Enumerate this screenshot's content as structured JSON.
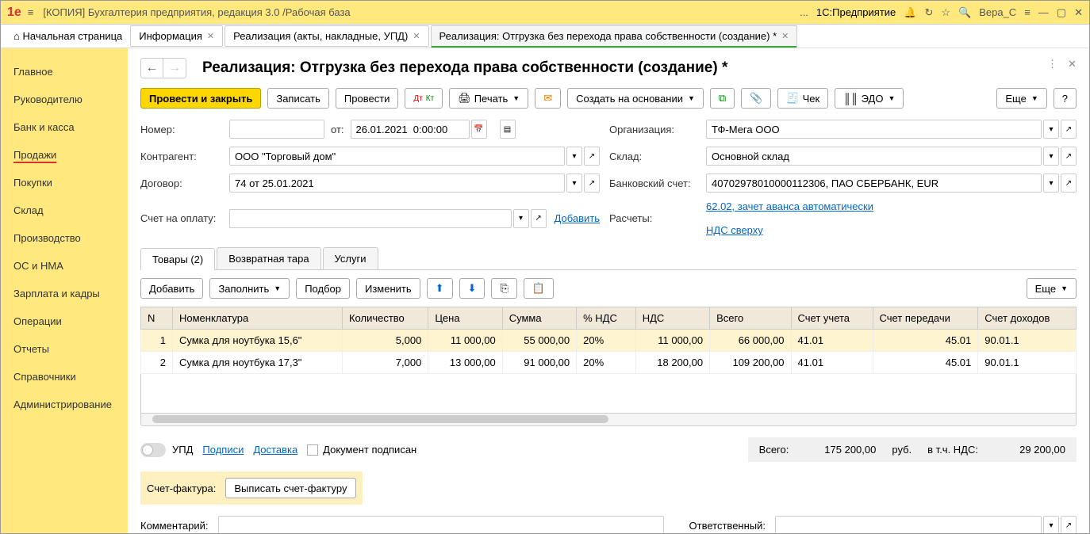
{
  "titlebar": {
    "app_title": "[КОПИЯ] Бухгалтерия предприятия, редакция 3.0 /Рабочая база",
    "platform": "1С:Предприятие",
    "user": "Вера_С"
  },
  "top_tabs": {
    "home": "Начальная страница",
    "items": [
      "Информация",
      "Реализация (акты, накладные, УПД)",
      "Реализация: Отгрузка без перехода права собственности (создание) *"
    ]
  },
  "sidebar": {
    "items": [
      "Главное",
      "Руководителю",
      "Банк и касса",
      "Продажи",
      "Покупки",
      "Склад",
      "Производство",
      "ОС и НМА",
      "Зарплата и кадры",
      "Операции",
      "Отчеты",
      "Справочники",
      "Администрирование"
    ],
    "active_index": 3
  },
  "page": {
    "title": "Реализация: Отгрузка без перехода права собственности (создание) *"
  },
  "toolbar": {
    "post_close": "Провести и закрыть",
    "save": "Записать",
    "post": "Провести",
    "print": "Печать",
    "create_based": "Создать на основании",
    "check": "Чек",
    "edo": "ЭДО",
    "more": "Еще"
  },
  "form": {
    "number_label": "Номер:",
    "number": "",
    "from_label": "от:",
    "date": "26.01.2021  0:00:00",
    "org_label": "Организация:",
    "org": "ТФ-Мега ООО",
    "counterparty_label": "Контрагент:",
    "counterparty": "ООО \"Торговый дом\"",
    "warehouse_label": "Склад:",
    "warehouse": "Основной склад",
    "contract_label": "Договор:",
    "contract": "74 от 25.01.2021",
    "bank_label": "Банковский счет:",
    "bank": "40702978010000112306, ПАО СБЕРБАНК, EUR",
    "invoice_pay_label": "Счет на оплату:",
    "invoice_pay": "",
    "add_link": "Добавить",
    "calc_label": "Расчеты:",
    "calc_link": "62.02, зачет аванса автоматически",
    "vat_link": "НДС сверху"
  },
  "tabs": {
    "goods": "Товары (2)",
    "tare": "Возвратная тара",
    "services": "Услуги"
  },
  "table_toolbar": {
    "add": "Добавить",
    "fill": "Заполнить",
    "pick": "Подбор",
    "change": "Изменить",
    "more": "Еще"
  },
  "table": {
    "headers": [
      "N",
      "Номенклатура",
      "Количество",
      "Цена",
      "Сумма",
      "% НДС",
      "НДС",
      "Всего",
      "Счет учета",
      "Счет передачи",
      "Счет доходов"
    ],
    "rows": [
      {
        "n": "1",
        "name": "Сумка для ноутбука 15,6\"",
        "qty": "5,000",
        "price": "11 000,00",
        "sum": "55 000,00",
        "vat_pct": "20%",
        "vat": "11 000,00",
        "total": "66 000,00",
        "acc": "41.01",
        "acc_trans": "45.01",
        "acc_inc": "90.01.1"
      },
      {
        "n": "2",
        "name": "Сумка для ноутбука 17,3\"",
        "qty": "7,000",
        "price": "13 000,00",
        "sum": "91 000,00",
        "vat_pct": "20%",
        "vat": "18 200,00",
        "total": "109 200,00",
        "acc": "41.01",
        "acc_trans": "45.01",
        "acc_inc": "90.01.1"
      }
    ]
  },
  "footer": {
    "upd": "УПД",
    "signatures": "Подписи",
    "delivery": "Доставка",
    "doc_signed": "Документ подписан",
    "total_label": "Всего:",
    "total": "175 200,00",
    "currency": "руб.",
    "vat_label": "в т.ч. НДС:",
    "vat_total": "29 200,00"
  },
  "invoice_section": {
    "label": "Счет-фактура:",
    "button": "Выписать счет-фактуру"
  },
  "bottom": {
    "comment_label": "Комментарий:",
    "responsible_label": "Ответственный:"
  }
}
